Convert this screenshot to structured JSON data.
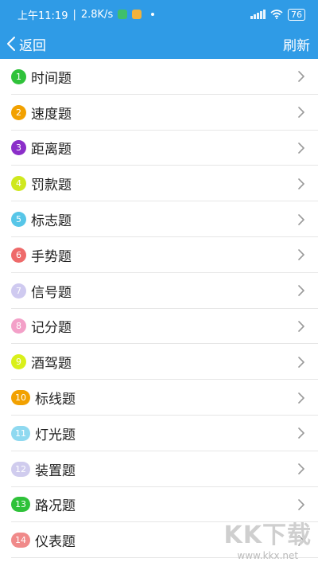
{
  "status": {
    "time": "上午11:19",
    "network": "2.8K/s",
    "battery": "76"
  },
  "nav": {
    "back_label": "返回",
    "refresh_label": "刷新"
  },
  "items": [
    {
      "num": "1",
      "label": "时间题",
      "color": "#2fc23a"
    },
    {
      "num": "2",
      "label": "速度题",
      "color": "#f2a100"
    },
    {
      "num": "3",
      "label": "距离题",
      "color": "#8b2ec9"
    },
    {
      "num": "4",
      "label": "罚款题",
      "color": "#cfe81e"
    },
    {
      "num": "5",
      "label": "标志题",
      "color": "#57c6e8"
    },
    {
      "num": "6",
      "label": "手势题",
      "color": "#ee6a6a"
    },
    {
      "num": "7",
      "label": "信号题",
      "color": "#cfcaf0"
    },
    {
      "num": "8",
      "label": "记分题",
      "color": "#f3a0c8"
    },
    {
      "num": "9",
      "label": "酒驾题",
      "color": "#d9f01a"
    },
    {
      "num": "10",
      "label": "标线题",
      "color": "#f2a100"
    },
    {
      "num": "11",
      "label": "灯光题",
      "color": "#8fd9f0"
    },
    {
      "num": "12",
      "label": "装置题",
      "color": "#d0ccee"
    },
    {
      "num": "13",
      "label": "路况题",
      "color": "#2fc23a"
    },
    {
      "num": "14",
      "label": "仪表题",
      "color": "#f08a8a"
    }
  ],
  "watermark": {
    "title": "KK下载",
    "url": "www.kkx.net"
  }
}
